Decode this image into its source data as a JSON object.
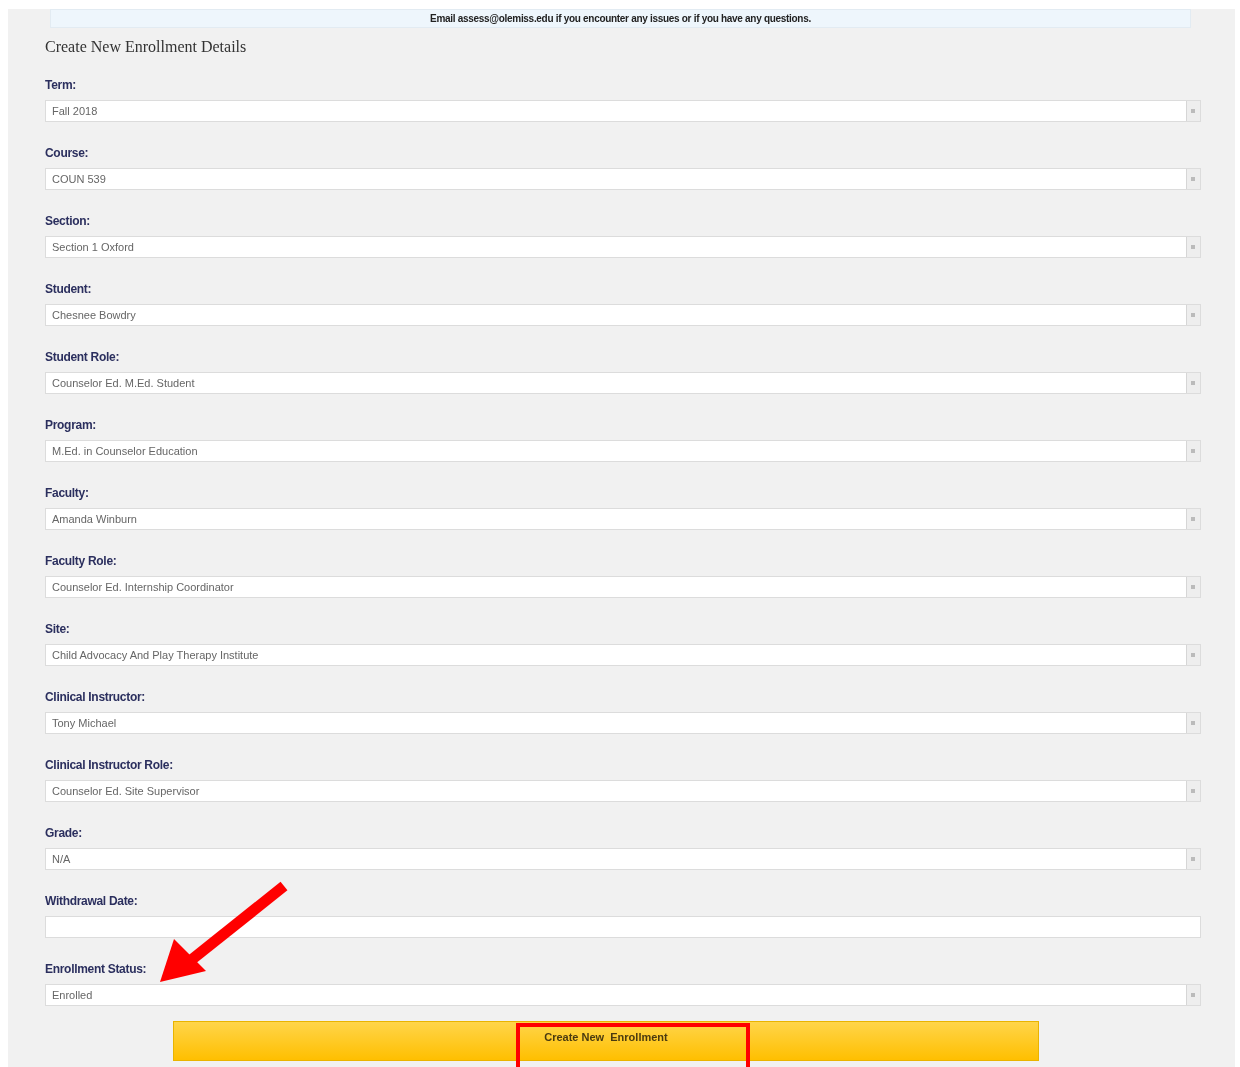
{
  "banner": {
    "text": "Email assess@olemiss.edu if you encounter any issues or if you have any questions."
  },
  "heading": "Create New Enrollment Details",
  "fields": [
    {
      "label": "Term:",
      "kind": "select",
      "value": "Fall 2018"
    },
    {
      "label": "Course:",
      "kind": "select",
      "value": "COUN 539"
    },
    {
      "label": "Section:",
      "kind": "select",
      "value": "Section 1 Oxford"
    },
    {
      "label": "Student:",
      "kind": "select",
      "value": "Chesnee Bowdry"
    },
    {
      "label": "Student Role:",
      "kind": "select",
      "value": "Counselor Ed. M.Ed. Student"
    },
    {
      "label": "Program:",
      "kind": "select",
      "value": "M.Ed. in Counselor Education"
    },
    {
      "label": "Faculty:",
      "kind": "select",
      "value": "Amanda Winburn"
    },
    {
      "label": "Faculty Role:",
      "kind": "select",
      "value": "Counselor Ed. Internship Coordinator"
    },
    {
      "label": "Site:",
      "kind": "select",
      "value": "Child Advocacy And Play Therapy Institute"
    },
    {
      "label": "Clinical Instructor:",
      "kind": "select",
      "value": "Tony Michael"
    },
    {
      "label": "Clinical Instructor Role:",
      "kind": "select",
      "value": "Counselor Ed. Site Supervisor"
    },
    {
      "label": "Grade:",
      "kind": "select",
      "value": "N/A"
    },
    {
      "label": "Withdrawal Date:",
      "kind": "text"
    },
    {
      "label": "Enrollment Status:",
      "kind": "select",
      "value": "Enrolled"
    }
  ],
  "submit_button": "Create New  Enrollment"
}
